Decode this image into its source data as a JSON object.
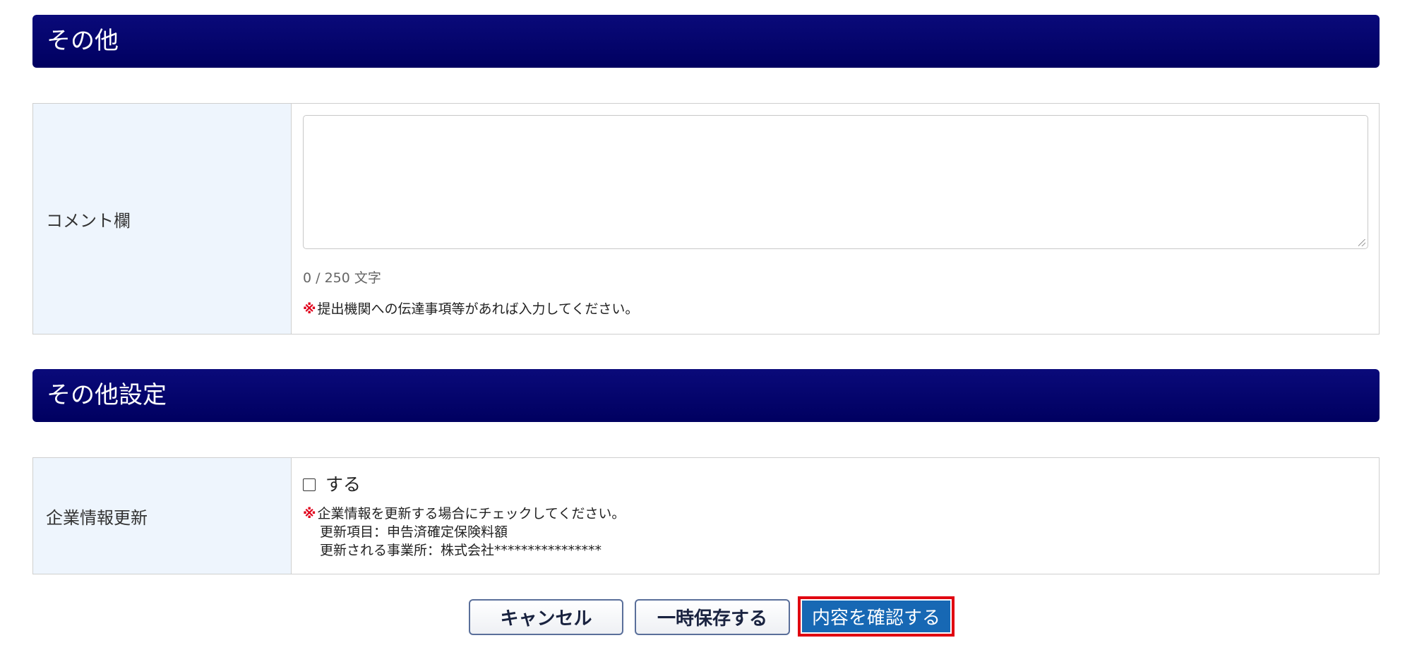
{
  "sections": {
    "other": {
      "title": "その他",
      "comment": {
        "label": "コメント欄",
        "value": "",
        "counter": "0 / 250 文字",
        "note_mark": "※",
        "note": "提出機関への伝達事項等があれば入力してください。"
      }
    },
    "other_settings": {
      "title": "その他設定",
      "company_update": {
        "label": "企業情報更新",
        "checkbox_label": "する",
        "checked": false,
        "note_mark": "※",
        "note_lines": [
          "企業情報を更新する場合にチェックしてください。",
          "更新項目：申告済確定保険料額",
          "更新される事業所：株式会社****************"
        ]
      }
    }
  },
  "buttons": {
    "cancel": "キャンセル",
    "save_draft": "一時保存する",
    "confirm": "内容を確認する"
  },
  "colors": {
    "header_bg": "#000060",
    "label_bg": "#eef5fd",
    "note_mark": "#e0001b",
    "confirm_bg": "#1768b4",
    "highlight_border": "#e00010"
  }
}
